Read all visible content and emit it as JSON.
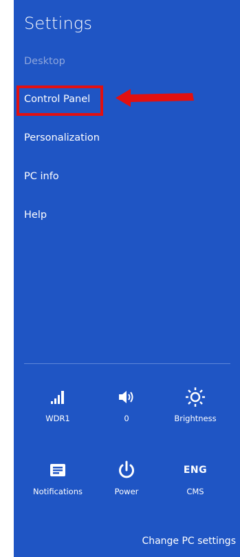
{
  "charm": {
    "title": "Settings",
    "items": [
      {
        "label": "Desktop",
        "enabled": false
      },
      {
        "label": "Control Panel",
        "enabled": true,
        "highlighted": true
      },
      {
        "label": "Personalization",
        "enabled": true
      },
      {
        "label": "PC info",
        "enabled": true
      },
      {
        "label": "Help",
        "enabled": true
      }
    ]
  },
  "quick_settings": {
    "network": {
      "label": "WDR1",
      "icon": "network-signal-icon"
    },
    "volume": {
      "label": "0",
      "icon": "speaker-icon"
    },
    "brightness": {
      "label": "Brightness",
      "icon": "sun-icon"
    },
    "notifications": {
      "label": "Notifications",
      "icon": "notifications-icon"
    },
    "power": {
      "label": "Power",
      "icon": "power-icon"
    },
    "keyboard": {
      "label": "CMS",
      "code": "ENG",
      "icon": "keyboard-language-icon"
    }
  },
  "footer": {
    "change_settings": "Change PC settings"
  },
  "colors": {
    "charm_background": "#1f55c4",
    "disabled_text": "#8ea6dd",
    "highlight": "#e21010"
  }
}
